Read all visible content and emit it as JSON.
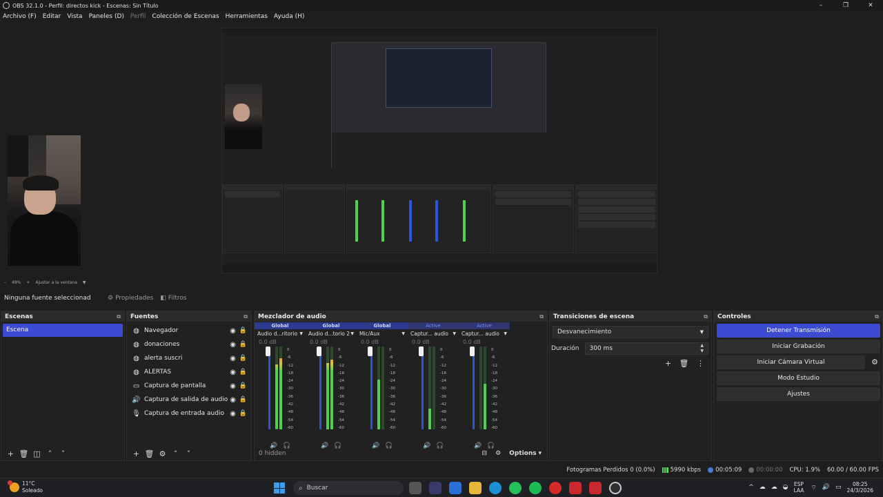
{
  "window": {
    "title": "OBS 32.1.0 - Perfil: directos kick - Escenas: Sin Título",
    "controls": [
      "–",
      "❐",
      "✕"
    ]
  },
  "menu": [
    {
      "label": "Archivo (F)",
      "enabled": true
    },
    {
      "label": "Editar",
      "enabled": true
    },
    {
      "label": "Vista",
      "enabled": true
    },
    {
      "label": "Paneles (D)",
      "enabled": true
    },
    {
      "label": "Perfil",
      "enabled": false
    },
    {
      "label": "Colección de Escenas",
      "enabled": true
    },
    {
      "label": "Herramientas",
      "enabled": true
    },
    {
      "label": "Ayuda (H)",
      "enabled": true
    }
  ],
  "preview": {
    "zoom_minus": "–",
    "zoom_level": "49%",
    "zoom_plus": "+",
    "fit_label": "Ajustar a la ventana"
  },
  "context": {
    "no_source": "Ninguna fuente seleccionad",
    "properties_label": "Propiedades",
    "filters_label": "Filtros"
  },
  "scenes": {
    "title": "Escenas",
    "items": [
      {
        "label": "Escena",
        "selected": true
      }
    ]
  },
  "sources": {
    "title": "Fuentes",
    "items": [
      {
        "label": "Navegador",
        "icon": "globe-icon"
      },
      {
        "label": "donaciones",
        "icon": "globe-icon"
      },
      {
        "label": "alerta suscri",
        "icon": "globe-icon"
      },
      {
        "label": "ALERTAS",
        "icon": "globe-icon"
      },
      {
        "label": "Captura de pantalla",
        "icon": "monitor-icon"
      },
      {
        "label": "Captura de salida de audio",
        "icon": "speaker-icon"
      },
      {
        "label": "Captura de entrada audio",
        "icon": "microphone-icon"
      }
    ]
  },
  "mixer": {
    "title": "Mezclador de audio",
    "ticks": [
      "0",
      "-6",
      "-12",
      "-18",
      "-24",
      "-30",
      "-36",
      "-42",
      "-48",
      "-54",
      "-60"
    ],
    "channels": [
      {
        "tag": "Global",
        "name": "Audio d...ritorio",
        "db": "0.0 dB",
        "level_left": 0.78,
        "level_right": 0.86,
        "active": false
      },
      {
        "tag": "Global",
        "name": "Audio d...torio 2",
        "db": "0.0 dB",
        "level_left": 0.8,
        "level_right": 0.84,
        "active": false
      },
      {
        "tag": "Global",
        "name": "Mic/Aux",
        "db": "0.0 dB",
        "level_left": 0.6,
        "level_right": 0.0,
        "active": false
      },
      {
        "tag": "Active",
        "name": "Captur... audio",
        "db": "0.0 dB",
        "level_left": 0.25,
        "level_right": 0.0,
        "active": true
      },
      {
        "tag": "Active",
        "name": "Captur... audio",
        "db": "0.0 dB",
        "level_left": 0.0,
        "level_right": 0.55,
        "active": true
      }
    ],
    "hidden_label": "0 hidden",
    "options_label": "Options"
  },
  "transitions": {
    "title": "Transiciones de escena",
    "selected": "Desvanecimiento",
    "duration_label": "Duración",
    "duration_value": "300 ms"
  },
  "controls": {
    "title": "Controles",
    "stop_stream": "Detener Transmisión",
    "start_recording": "Iniciar Grabación",
    "start_virtualcam": "Iniciar Cámara Virtual",
    "studio_mode": "Modo Estudio",
    "settings": "Ajustes"
  },
  "status": {
    "dropped_frames": "Fotogramas Perdidos 0 (0.0%)",
    "bitrate": "5990 kbps",
    "stream_time": "00:05:09",
    "record_time": "00:00:00",
    "cpu": "CPU: 1.9%",
    "fps": "60.00 / 60.00 FPS"
  },
  "taskbar": {
    "temperature": "11°C",
    "weather": "Soleado",
    "search_placeholder": "Buscar",
    "lang_top": "ESP",
    "lang_bottom": "LAA",
    "time": "08:25",
    "date": "24/3/2026",
    "tray_chevron": "^"
  },
  "colors": {
    "accent": "#3c4bd1",
    "meter_green": "#4fd14f",
    "meter_yellow": "#e0c23a",
    "meter_red": "#d9383a",
    "fader_blue": "#2a56d9"
  }
}
